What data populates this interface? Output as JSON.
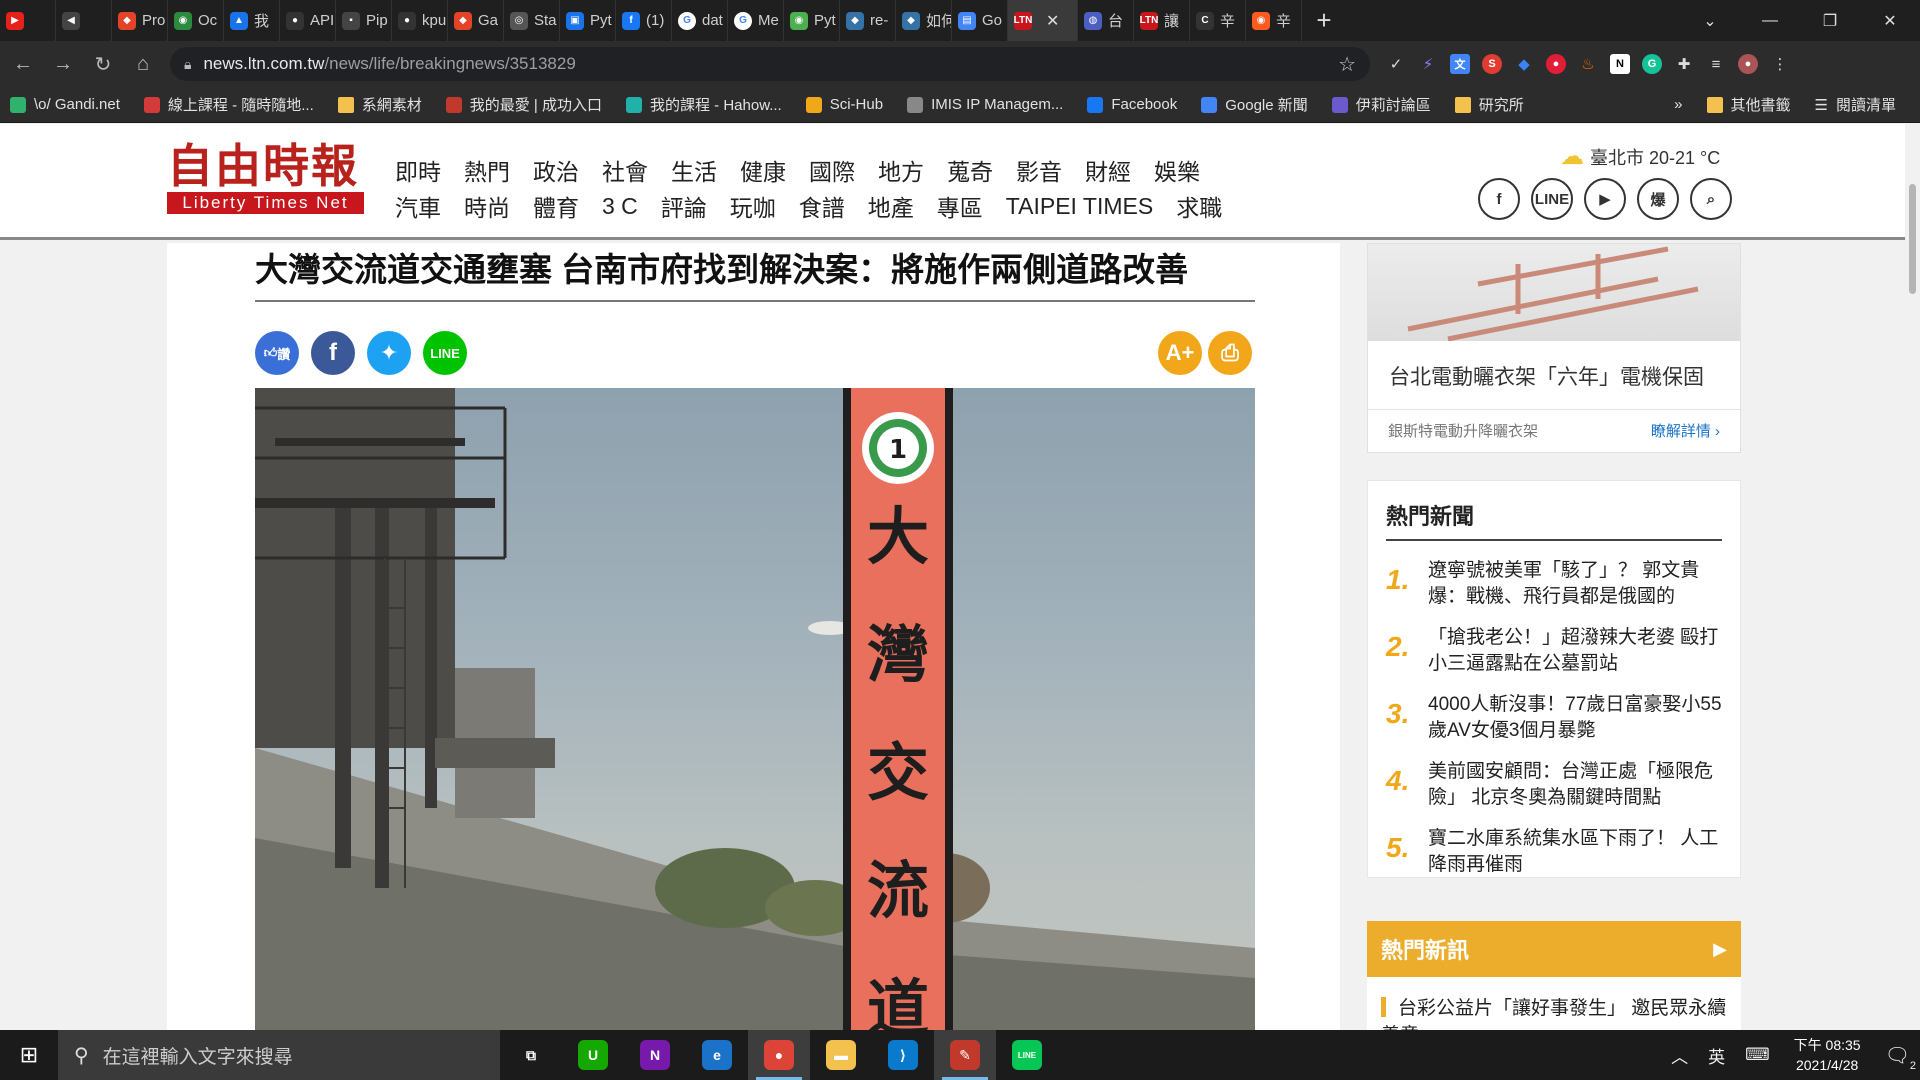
{
  "browser": {
    "tabs": [
      {
        "label": "",
        "color": "#e62117",
        "glyph": "▶"
      },
      {
        "label": "",
        "color": "#444444",
        "glyph": "◀"
      },
      {
        "label": "Pro",
        "color": "#e24329",
        "glyph": "◆"
      },
      {
        "label": "Oc",
        "color": "#2b8a3e",
        "glyph": "◉"
      },
      {
        "label": "我",
        "color": "#1a73e8",
        "glyph": "▲"
      },
      {
        "label": "API",
        "color": "#333333",
        "glyph": "●"
      },
      {
        "label": "Pip",
        "color": "#444444",
        "glyph": "▪"
      },
      {
        "label": "kpu",
        "color": "#333333",
        "glyph": "●"
      },
      {
        "label": "Ga",
        "color": "#e24329",
        "glyph": "◆"
      },
      {
        "label": "Sta",
        "color": "#555555",
        "glyph": "◎"
      },
      {
        "label": "Pyt",
        "color": "#1a73e8",
        "glyph": "▣"
      },
      {
        "label": "(1)",
        "color": "#1877f2",
        "glyph": "f"
      },
      {
        "label": "dat",
        "color": "#ffffff",
        "glyph": "G"
      },
      {
        "label": "Me",
        "color": "#ffffff",
        "glyph": "G"
      },
      {
        "label": "Pyt",
        "color": "#4caf50",
        "glyph": "◉"
      },
      {
        "label": "re-",
        "color": "#3572a5",
        "glyph": "◆"
      },
      {
        "label": "如何",
        "color": "#3572a5",
        "glyph": "◆"
      },
      {
        "label": "Go",
        "color": "#4285f4",
        "glyph": "▤"
      },
      {
        "label": "",
        "color": "#c8161d",
        "glyph": "LTN",
        "active": true
      },
      {
        "label": "台",
        "color": "#4a5fc1",
        "glyph": "◍"
      },
      {
        "label": "讓",
        "color": "#c8161d",
        "glyph": "LTN"
      },
      {
        "label": "辛",
        "color": "#333333",
        "glyph": "C"
      },
      {
        "label": "辛",
        "color": "#ff5a1f",
        "glyph": "◉"
      }
    ],
    "url_host": "news.ltn.com.tw",
    "url_path": "/news/life/breakingnews/3513829",
    "bookmarks": [
      {
        "label": "\\o/ Gandi.net",
        "color": "#2fb36c"
      },
      {
        "label": "線上課程 - 隨時隨地...",
        "color": "#d43a3a"
      },
      {
        "label": "系網素材",
        "color": "folder"
      },
      {
        "label": "我的最愛 | 成功入口",
        "color": "#c0392b"
      },
      {
        "label": "我的課程 - Hahow...",
        "color": "#20b2aa"
      },
      {
        "label": "Sci-Hub",
        "color": "#f0a818"
      },
      {
        "label": "IMIS IP Managem...",
        "color": "#888888"
      },
      {
        "label": "Facebook",
        "color": "#1877f2"
      },
      {
        "label": "Google 新聞",
        "color": "#4285f4"
      },
      {
        "label": "伊莉討論區",
        "color": "#6a5acd"
      },
      {
        "label": "研究所",
        "color": "folder"
      }
    ],
    "bookmarks_overflow": "»",
    "other_bookmarks": "其他書籤",
    "reading_list": "閱讀清單"
  },
  "site": {
    "logo_cn": "自由時報",
    "logo_en": "Liberty Times Net",
    "nav_row1": [
      "即時",
      "熱門",
      "政治",
      "社會",
      "生活",
      "健康",
      "國際",
      "地方",
      "蒐奇",
      "影音",
      "財經",
      "娛樂"
    ],
    "nav_row2": [
      "汽車",
      "時尚",
      "體育",
      "3 C",
      "評論",
      "玩咖",
      "食譜",
      "地產",
      "專區",
      "TAIPEI TIMES",
      "求職"
    ],
    "weather": "臺北市 20-21 °C",
    "social": [
      "f",
      "LINE",
      "▶",
      "爆",
      "⌕"
    ]
  },
  "article": {
    "headline": "大灣交流道交通壅塞 台南市府找到解決案：將施作兩側道路改善",
    "like_label": "讚",
    "share_line": "LINE",
    "font_tool": "A+",
    "print_tool": "⎙",
    "sign_text": [
      "大",
      "灣",
      "交",
      "流",
      "道"
    ],
    "sign_number": "1"
  },
  "sidebar": {
    "ad_title": "台北電動曬衣架「六年」電機保固",
    "ad_brand": "銀斯特電動升降曬衣架",
    "ad_more": "瞭解詳情 ›",
    "hot_title": "熱門新聞",
    "hot_items": [
      {
        "num": "1.",
        "text": "遼寧號被美軍「駭了」？ 郭文貴爆：戰機、飛行員都是俄國的"
      },
      {
        "num": "2.",
        "text": "「搶我老公！」超潑辣大老婆 毆打小三逼露點在公墓罰站"
      },
      {
        "num": "3.",
        "text": "4000人斬沒事！77歲日富豪娶小55歲AV女優3個月暴斃"
      },
      {
        "num": "4.",
        "text": "美前國安顧問：台灣正處「極限危險」 北京冬奧為關鍵時間點"
      },
      {
        "num": "5.",
        "text": "寶二水庫系統集水區下雨了！ 人工降雨再催雨"
      }
    ],
    "hotnew_title": "熱門新訊",
    "hotnew_item": "台彩公益片「讓好事發生」 邀民眾永續善意"
  },
  "taskbar": {
    "search_placeholder": "在這裡輸入文字來搜尋",
    "apps": [
      {
        "name": "task-view",
        "glyph": "⧉",
        "color": "transparent"
      },
      {
        "name": "upwork",
        "glyph": "U",
        "color": "#14a800"
      },
      {
        "name": "onenote",
        "glyph": "N",
        "color": "#7719aa"
      },
      {
        "name": "edge-dev",
        "glyph": "e",
        "color": "#1a73c9"
      },
      {
        "name": "chrome",
        "glyph": "●",
        "color": "#db4437",
        "active": true
      },
      {
        "name": "file-explorer",
        "glyph": "▬",
        "color": "#f2c14e"
      },
      {
        "name": "vscode",
        "glyph": "⟩",
        "color": "#0a7acc"
      },
      {
        "name": "notepad",
        "glyph": "✎",
        "color": "#c0392b",
        "active": true
      },
      {
        "name": "line",
        "glyph": "LINE",
        "color": "#06c755"
      }
    ],
    "tray_chevron": "︿",
    "ime": "英",
    "time": "下午 08:35",
    "date": "2021/4/28",
    "notif_count": "2"
  }
}
